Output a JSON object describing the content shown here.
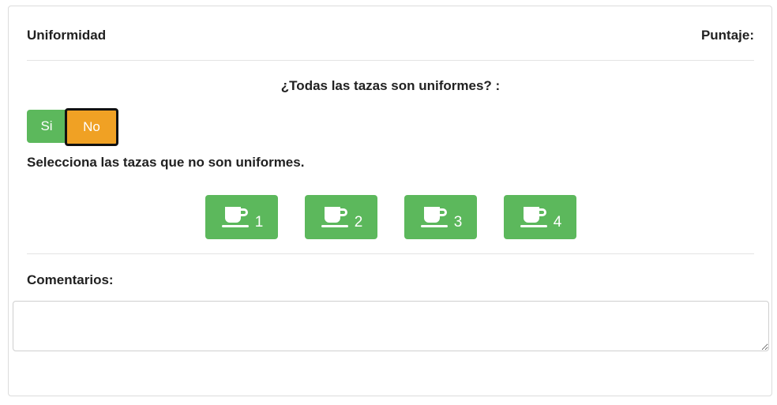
{
  "section": {
    "title": "Uniformidad",
    "score_label": "Puntaje:"
  },
  "question": {
    "text": "¿Todas las tazas son uniformes? :",
    "options": {
      "yes_label": "Si",
      "no_label": "No",
      "selected": "No"
    }
  },
  "cups": {
    "instruction": "Selecciona las tazas que no son uniformes.",
    "icon": "coffee-cup-icon",
    "items": [
      {
        "label": "1"
      },
      {
        "label": "2"
      },
      {
        "label": "3"
      },
      {
        "label": "4"
      }
    ]
  },
  "comments": {
    "label": "Comentarios:",
    "value": "",
    "placeholder": ""
  },
  "colors": {
    "green": "#5cb85c",
    "orange": "#f0a124"
  }
}
